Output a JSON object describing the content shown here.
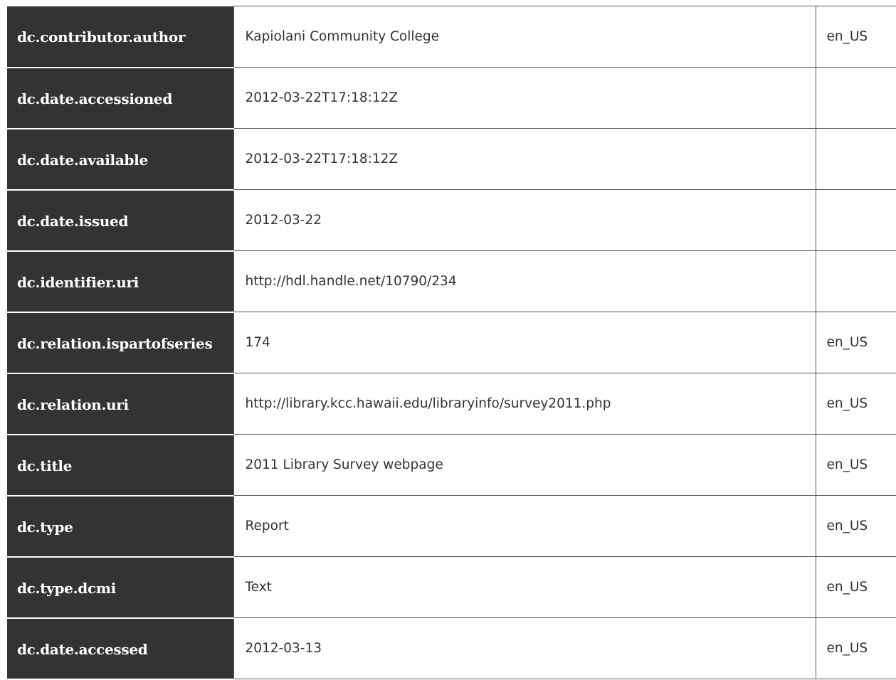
{
  "metadata": {
    "rows": [
      {
        "key": "dc.contributor.author",
        "value": "Kapiolani Community College",
        "lang": "en_US"
      },
      {
        "key": "dc.date.accessioned",
        "value": "2012-03-22T17:18:12Z",
        "lang": ""
      },
      {
        "key": "dc.date.available",
        "value": "2012-03-22T17:18:12Z",
        "lang": ""
      },
      {
        "key": "dc.date.issued",
        "value": "2012-03-22",
        "lang": ""
      },
      {
        "key": "dc.identifier.uri",
        "value": "http://hdl.handle.net/10790/234",
        "lang": ""
      },
      {
        "key": "dc.relation.ispartofseries",
        "value": "174",
        "lang": "en_US"
      },
      {
        "key": "dc.relation.uri",
        "value": "http://library.kcc.hawaii.edu/libraryinfo/survey2011.php",
        "lang": "en_US"
      },
      {
        "key": "dc.title",
        "value": "2011 Library Survey webpage",
        "lang": "en_US"
      },
      {
        "key": "dc.type",
        "value": "Report",
        "lang": "en_US"
      },
      {
        "key": "dc.type.dcmi",
        "value": "Text",
        "lang": "en_US"
      },
      {
        "key": "dc.date.accessed",
        "value": "2012-03-13",
        "lang": "en_US"
      }
    ]
  }
}
